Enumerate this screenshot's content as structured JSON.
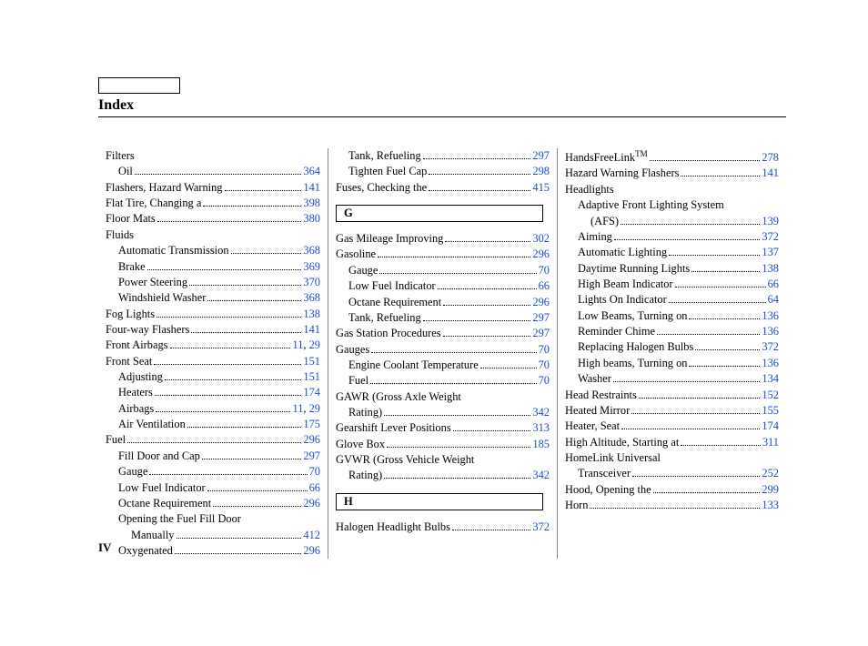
{
  "title": "Index",
  "pageNumber": "IV",
  "columns": [
    [
      {
        "type": "heading",
        "indent": 0,
        "label": "Filters"
      },
      {
        "type": "entry",
        "indent": 1,
        "label": "Oil",
        "pages": [
          "364"
        ]
      },
      {
        "type": "entry",
        "indent": 0,
        "label": "Flashers, Hazard Warning",
        "pages": [
          "141"
        ]
      },
      {
        "type": "entry",
        "indent": 0,
        "label": "Flat Tire, Changing a",
        "pages": [
          "398"
        ]
      },
      {
        "type": "entry",
        "indent": 0,
        "label": "Floor Mats",
        "pages": [
          "380"
        ]
      },
      {
        "type": "heading",
        "indent": 0,
        "label": "Fluids"
      },
      {
        "type": "entry",
        "indent": 1,
        "label": "Automatic Transmission",
        "pages": [
          "368"
        ]
      },
      {
        "type": "entry",
        "indent": 1,
        "label": "Brake",
        "pages": [
          "369"
        ]
      },
      {
        "type": "entry",
        "indent": 1,
        "label": "Power Steering",
        "pages": [
          "370"
        ]
      },
      {
        "type": "entry",
        "indent": 1,
        "label": "Windshield Washer",
        "pages": [
          "368"
        ]
      },
      {
        "type": "entry",
        "indent": 0,
        "label": "Fog Lights",
        "pages": [
          "138"
        ]
      },
      {
        "type": "entry",
        "indent": 0,
        "label": "Four-way Flashers",
        "pages": [
          "141"
        ]
      },
      {
        "type": "entry",
        "indent": 0,
        "label": "Front Airbags",
        "pages": [
          "11",
          "29"
        ]
      },
      {
        "type": "entry",
        "indent": 0,
        "label": "Front Seat",
        "pages": [
          "151"
        ]
      },
      {
        "type": "entry",
        "indent": 1,
        "label": "Adjusting",
        "pages": [
          "151"
        ]
      },
      {
        "type": "entry",
        "indent": 1,
        "label": "Heaters",
        "pages": [
          "174"
        ]
      },
      {
        "type": "entry",
        "indent": 1,
        "label": "Airbags",
        "pages": [
          "11",
          "29"
        ]
      },
      {
        "type": "entry",
        "indent": 1,
        "label": "Air Ventilation",
        "pages": [
          "175"
        ]
      },
      {
        "type": "entry",
        "indent": 0,
        "label": "Fuel",
        "pages": [
          "296"
        ]
      },
      {
        "type": "entry",
        "indent": 1,
        "label": "Fill Door and Cap",
        "pages": [
          "297"
        ]
      },
      {
        "type": "entry",
        "indent": 1,
        "label": "Gauge",
        "pages": [
          "70"
        ]
      },
      {
        "type": "entry",
        "indent": 1,
        "label": "Low Fuel Indicator",
        "pages": [
          "66"
        ]
      },
      {
        "type": "entry",
        "indent": 1,
        "label": "Octane Requirement",
        "pages": [
          "296"
        ]
      },
      {
        "type": "heading",
        "indent": 1,
        "label": "Opening the Fuel Fill Door"
      },
      {
        "type": "entry",
        "indent": 2,
        "label": "Manually",
        "pages": [
          "412"
        ]
      },
      {
        "type": "entry",
        "indent": 1,
        "label": "Oxygenated",
        "pages": [
          "296"
        ]
      }
    ],
    [
      {
        "type": "entry",
        "indent": 1,
        "label": "Tank, Refueling",
        "pages": [
          "297"
        ]
      },
      {
        "type": "entry",
        "indent": 1,
        "label": "Tighten Fuel Cap",
        "pages": [
          "298"
        ]
      },
      {
        "type": "entry",
        "indent": 0,
        "label": "Fuses, Checking the",
        "pages": [
          "415"
        ]
      },
      {
        "type": "letter",
        "label": "G"
      },
      {
        "type": "entry",
        "indent": 0,
        "label": "Gas Mileage Improving",
        "pages": [
          "302"
        ]
      },
      {
        "type": "entry",
        "indent": 0,
        "label": "Gasoline",
        "pages": [
          "296"
        ]
      },
      {
        "type": "entry",
        "indent": 1,
        "label": "Gauge",
        "pages": [
          "70"
        ]
      },
      {
        "type": "entry",
        "indent": 1,
        "label": "Low Fuel Indicator",
        "pages": [
          "66"
        ]
      },
      {
        "type": "entry",
        "indent": 1,
        "label": "Octane Requirement",
        "pages": [
          "296"
        ]
      },
      {
        "type": "entry",
        "indent": 1,
        "label": "Tank, Refueling",
        "pages": [
          "297"
        ]
      },
      {
        "type": "entry",
        "indent": 0,
        "label": "Gas Station Procedures",
        "pages": [
          "297"
        ]
      },
      {
        "type": "entry",
        "indent": 0,
        "label": "Gauges",
        "pages": [
          "70"
        ]
      },
      {
        "type": "entry",
        "indent": 1,
        "label": "Engine Coolant Temperature",
        "pages": [
          "70"
        ]
      },
      {
        "type": "entry",
        "indent": 1,
        "label": "Fuel",
        "pages": [
          "70"
        ]
      },
      {
        "type": "heading",
        "indent": 0,
        "label": "GAWR (Gross Axle Weight"
      },
      {
        "type": "entry",
        "indent": 1,
        "label": "Rating)",
        "pages": [
          "342"
        ]
      },
      {
        "type": "entry",
        "indent": 0,
        "label": "Gearshift Lever Positions",
        "pages": [
          "313"
        ]
      },
      {
        "type": "entry",
        "indent": 0,
        "label": "Glove Box",
        "pages": [
          "185"
        ]
      },
      {
        "type": "heading",
        "indent": 0,
        "label": "GVWR (Gross Vehicle Weight"
      },
      {
        "type": "entry",
        "indent": 1,
        "label": "Rating)",
        "pages": [
          "342"
        ]
      },
      {
        "type": "letter",
        "label": "H"
      },
      {
        "type": "entry",
        "indent": 0,
        "label": "Halogen Headlight Bulbs",
        "pages": [
          "372"
        ]
      }
    ],
    [
      {
        "type": "entry",
        "indent": 0,
        "label": "HandsFreeLink",
        "trademark": true,
        "pages": [
          "278"
        ]
      },
      {
        "type": "entry",
        "indent": 0,
        "label": "Hazard Warning Flashers",
        "pages": [
          "141"
        ]
      },
      {
        "type": "heading",
        "indent": 0,
        "label": "Headlights"
      },
      {
        "type": "heading",
        "indent": 1,
        "label": "Adaptive Front Lighting System"
      },
      {
        "type": "entry",
        "indent": 2,
        "label": "(AFS)",
        "pages": [
          "139"
        ]
      },
      {
        "type": "entry",
        "indent": 1,
        "label": "Aiming",
        "pages": [
          "372"
        ]
      },
      {
        "type": "entry",
        "indent": 1,
        "label": "Automatic Lighting",
        "pages": [
          "137"
        ]
      },
      {
        "type": "entry",
        "indent": 1,
        "label": "Daytime Running Lights",
        "pages": [
          "138"
        ]
      },
      {
        "type": "entry",
        "indent": 1,
        "label": "High Beam Indicator",
        "pages": [
          "66"
        ]
      },
      {
        "type": "entry",
        "indent": 1,
        "label": "Lights On Indicator",
        "pages": [
          "64"
        ]
      },
      {
        "type": "entry",
        "indent": 1,
        "label": "Low Beams, Turning on",
        "pages": [
          "136"
        ]
      },
      {
        "type": "entry",
        "indent": 1,
        "label": "Reminder Chime",
        "pages": [
          "136"
        ]
      },
      {
        "type": "entry",
        "indent": 1,
        "label": "Replacing Halogen Bulbs",
        "pages": [
          "372"
        ]
      },
      {
        "type": "entry",
        "indent": 1,
        "label": "High beams, Turning on",
        "pages": [
          "136"
        ]
      },
      {
        "type": "entry",
        "indent": 1,
        "label": "Washer",
        "pages": [
          "134"
        ]
      },
      {
        "type": "entry",
        "indent": 0,
        "label": "Head Restraints",
        "pages": [
          "152"
        ]
      },
      {
        "type": "entry",
        "indent": 0,
        "label": "Heated Mirror",
        "pages": [
          "155"
        ]
      },
      {
        "type": "entry",
        "indent": 0,
        "label": "Heater, Seat",
        "pages": [
          "174"
        ]
      },
      {
        "type": "entry",
        "indent": 0,
        "label": "High Altitude, Starting at",
        "pages": [
          "311"
        ]
      },
      {
        "type": "heading",
        "indent": 0,
        "label": "HomeLink Universal"
      },
      {
        "type": "entry",
        "indent": 1,
        "label": "Transceiver",
        "pages": [
          "252"
        ]
      },
      {
        "type": "entry",
        "indent": 0,
        "label": "Hood, Opening the",
        "pages": [
          "299"
        ]
      },
      {
        "type": "entry",
        "indent": 0,
        "label": "Horn",
        "pages": [
          "133"
        ]
      }
    ]
  ]
}
